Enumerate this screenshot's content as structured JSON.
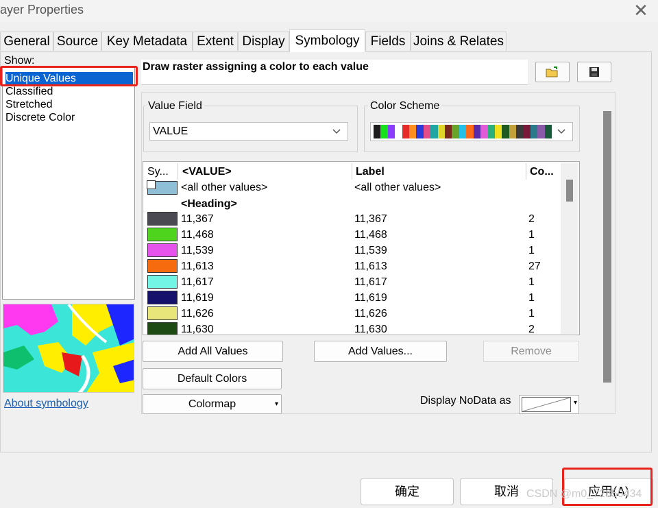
{
  "window": {
    "title": "ayer Properties"
  },
  "tabs": [
    {
      "label": "General"
    },
    {
      "label": "Source"
    },
    {
      "label": "Key Metadata"
    },
    {
      "label": "Extent"
    },
    {
      "label": "Display"
    },
    {
      "label": "Symbology"
    },
    {
      "label": "Fields"
    },
    {
      "label": "Joins & Relates"
    }
  ],
  "active_tab": "Symbology",
  "show": {
    "label": "Show:",
    "items": [
      {
        "label": "Unique Values"
      },
      {
        "label": "Classified"
      },
      {
        "label": "Stretched"
      },
      {
        "label": "Discrete Color"
      }
    ],
    "selected": "Unique Values"
  },
  "about_link": "About symbology",
  "description": "Draw raster assigning a color to each value",
  "value_field": {
    "label": "Value Field",
    "value": "VALUE"
  },
  "color_scheme": {
    "label": "Color Scheme",
    "colors": [
      "#1e1e1e",
      "#17e01c",
      "#8b3cff",
      "#ffffff",
      "#e62a2a",
      "#ff8f1f",
      "#2d3cd8",
      "#e34d8a",
      "#20a7a4",
      "#e0d52a",
      "#7a2a1a",
      "#6aa32a",
      "#25c0e8",
      "#ff6a1a",
      "#5a2aa8",
      "#e35ad8",
      "#2ab07a",
      "#f0e020",
      "#1f5a20",
      "#c3a03a",
      "#3a3a3a",
      "#7a1a3a",
      "#2a7a8a",
      "#8a5aa8",
      "#1a5a3a"
    ]
  },
  "grid": {
    "headers": {
      "symbol": "Sy...",
      "value": "<VALUE>",
      "label": "Label",
      "count": "Co..."
    },
    "other": {
      "value": "<all other values>",
      "label": "<all other values>",
      "color": "#8fbfd6"
    },
    "heading": "<Heading>",
    "rows": [
      {
        "value": "11,367",
        "label": "11,367",
        "count": "2",
        "color": "#4a4850"
      },
      {
        "value": "11,468",
        "label": "11,468",
        "count": "1",
        "color": "#4fd41e"
      },
      {
        "value": "11,539",
        "label": "11,539",
        "count": "1",
        "color": "#e653ec"
      },
      {
        "value": "11,613",
        "label": "11,613",
        "count": "27",
        "color": "#f76b0f"
      },
      {
        "value": "11,617",
        "label": "11,617",
        "count": "1",
        "color": "#73f5e6"
      },
      {
        "value": "11,619",
        "label": "11,619",
        "count": "1",
        "color": "#14106b"
      },
      {
        "value": "11,626",
        "label": "11,626",
        "count": "1",
        "color": "#e8e57a"
      },
      {
        "value": "11,630",
        "label": "11,630",
        "count": "2",
        "color": "#1e4a14"
      }
    ]
  },
  "buttons": {
    "add_all": "Add All Values",
    "add_values": "Add Values...",
    "remove": "Remove",
    "default_colors": "Default Colors",
    "colormap": "Colormap",
    "nodata_label": "Display NoData as",
    "ok": "确定",
    "cancel": "取消",
    "apply": "应用(A)"
  },
  "watermark": "CSDN @m0_72850434"
}
